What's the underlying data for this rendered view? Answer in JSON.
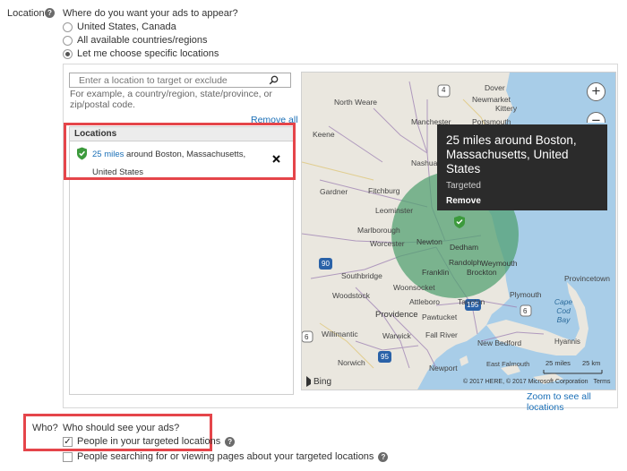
{
  "location": {
    "label": "Location",
    "question": "Where do you want your ads to appear?",
    "options": [
      {
        "label": "United States, Canada",
        "selected": false
      },
      {
        "label": "All available countries/regions",
        "selected": false
      },
      {
        "label": "Let me choose specific locations",
        "selected": true
      }
    ],
    "search": {
      "placeholder": "Enter a location to target or exclude",
      "value": "",
      "hint": "For example, a country/region, state/province, or zip/postal code."
    },
    "remove_all": "Remove all",
    "table_header": "Locations",
    "entries": [
      {
        "radius": "25 miles",
        "rest": " around Boston, Massachusetts, United States",
        "status": "targeted"
      }
    ]
  },
  "map": {
    "popup": {
      "title": "25 miles around Boston, Massachusetts, United States",
      "status": "Targeted",
      "remove": "Remove"
    },
    "zoom_in": "+",
    "zoom_out": "−",
    "bing": "Bing",
    "attribution": "© 2017 HERE, © 2017 Microsoft Corporation",
    "terms": "Terms",
    "scale_miles": "25 miles",
    "scale_km": "25 km",
    "labels": {
      "dover": "Dover",
      "newmarket": "Newmarket",
      "kittery": "Kittery",
      "north_weare": "North Weare",
      "manchester": "Manchester",
      "portsmouth": "Portsmouth",
      "keene": "Keene",
      "nashua": "Nashua",
      "gardner": "Gardner",
      "fitchburg": "Fitchburg",
      "leominster": "Leominster",
      "marlborough": "Marlborough",
      "worcester": "Worcester",
      "newton": "Newton",
      "dedham": "Dedham",
      "randolph": "Randolph",
      "weymouth": "Weymouth",
      "franklin": "Franklin",
      "brockton": "Brockton",
      "southbridge": "Southbridge",
      "woonsocket": "Woonsocket",
      "woodstock": "Woodstock",
      "taunton": "Taunton",
      "plymouth": "Plymouth",
      "provincetown": "Provincetown",
      "cape_cod_bay": "Cape Cod Bay",
      "attleboro": "Attleboro",
      "providence": "Providence",
      "pawtucket": "Pawtucket",
      "willimantic": "Willimantic",
      "warwick": "Warwick",
      "fall_river": "Fall River",
      "new_bedford": "New Bedford",
      "hyannis": "Hyannis",
      "norwich": "Norwich",
      "newport": "Newport",
      "east_falmouth": "East Falmouth",
      "route_4": "4",
      "route_90": "90",
      "route_95": "95",
      "route_195": "195",
      "route_6a": "6",
      "route_6b": "6"
    },
    "colors": {
      "water": "#a8cde8",
      "land": "#eae7df",
      "target_circle": "#4f9f6f",
      "interstate": "#2a62a8"
    },
    "zoom_link": "Zoom to see all locations"
  },
  "who": {
    "label": "Who?",
    "question": "Who should see your ads?",
    "options": [
      {
        "label": "People in your targeted locations",
        "checked": true
      },
      {
        "label": "People searching for or viewing pages about your targeted locations",
        "checked": false
      }
    ],
    "help": "?"
  },
  "help_glyph": "?"
}
